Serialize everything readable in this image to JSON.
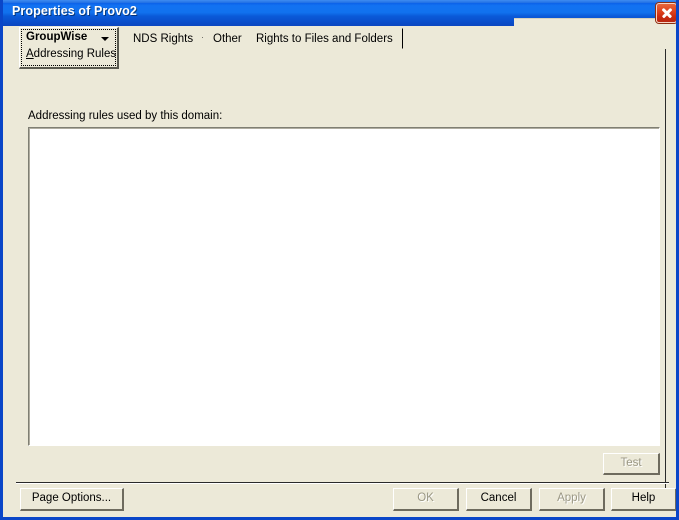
{
  "window": {
    "title": "Properties of Provo2",
    "close_icon": "close-icon",
    "accent_color": "#0a46c8",
    "face_color": "#ece9d8",
    "close_color": "#cf3318"
  },
  "tabs": [
    {
      "id": "groupwise",
      "label": "GroupWise",
      "sublabel": "Addressing Rules",
      "has_dropdown": true,
      "selected": true
    },
    {
      "id": "nds-rights",
      "label": "NDS Rights",
      "has_dropdown": true,
      "selected": false
    },
    {
      "id": "other",
      "label": "Other",
      "has_dropdown": false,
      "selected": false
    },
    {
      "id": "rights-to-files",
      "label": "Rights to Files and Folders",
      "has_dropdown": false,
      "selected": false
    }
  ],
  "page": {
    "list_label": "Addressing rules used by this domain:",
    "list_items": [],
    "test_button": {
      "label": "Test",
      "enabled": false
    }
  },
  "footer": {
    "page_options": {
      "label": "Page Options...",
      "enabled": true
    },
    "ok": {
      "label": "OK",
      "enabled": false
    },
    "cancel": {
      "label": "Cancel",
      "enabled": true
    },
    "apply": {
      "label": "Apply",
      "enabled": false
    },
    "help": {
      "label": "Help",
      "enabled": true
    }
  }
}
